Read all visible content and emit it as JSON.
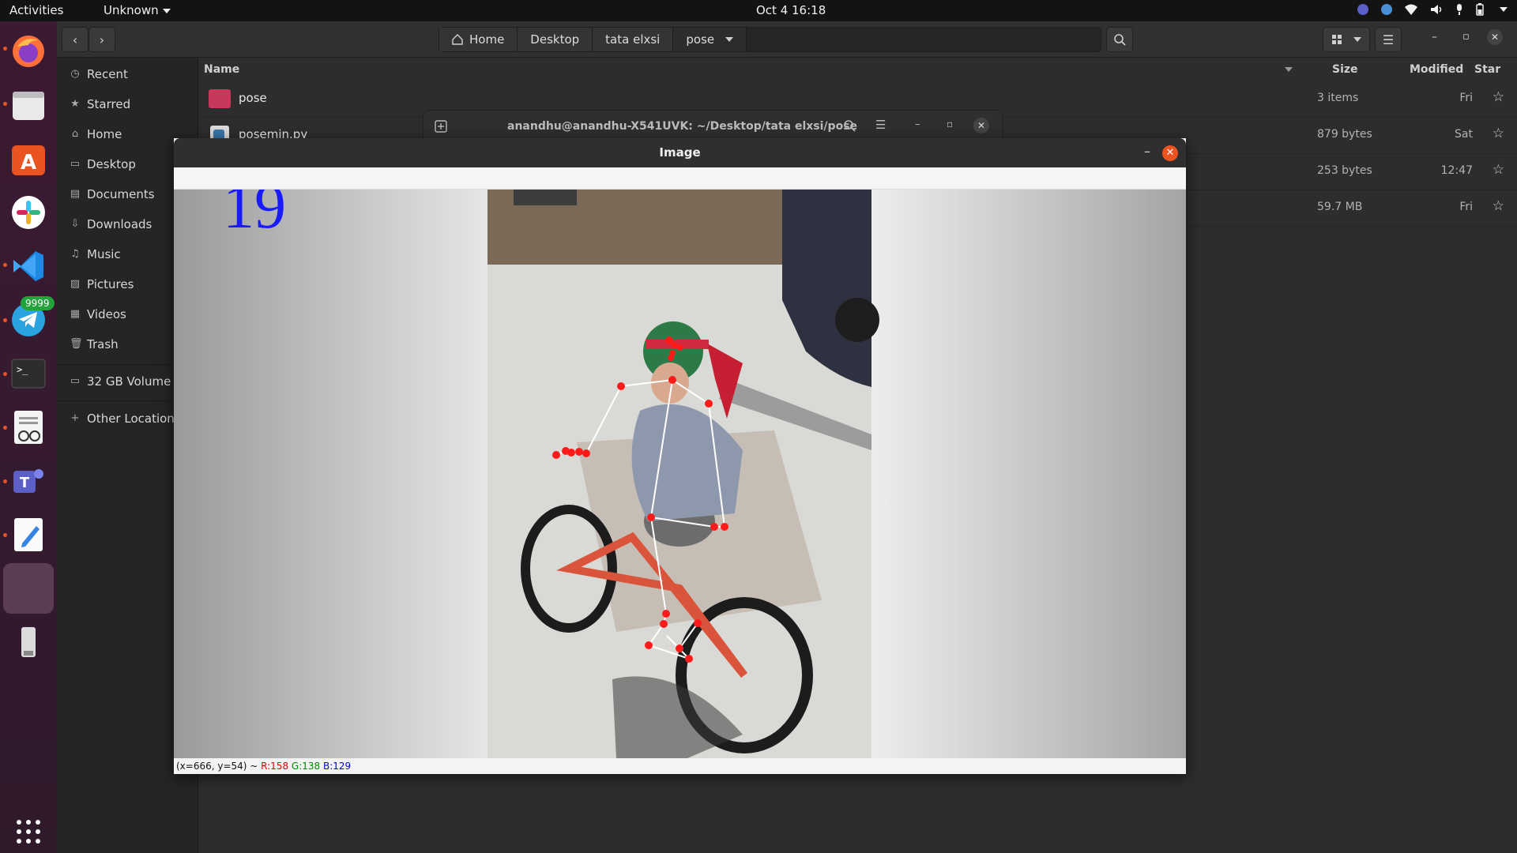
{
  "topbar": {
    "activities": "Activities",
    "app_menu": "Unknown",
    "clock": "Oct 4  16:18",
    "tray_icons": [
      "teams-tray-icon",
      "globe-icon",
      "wifi-icon",
      "volume-icon",
      "microphone-icon",
      "battery-icon",
      "chevron-down-icon"
    ]
  },
  "dock": {
    "apps": [
      "firefox",
      "files",
      "ubuntu-software",
      "slack",
      "vscode",
      "telegram",
      "terminal",
      "document-viewer",
      "teams",
      "text-editor",
      "show-apps-placeholder",
      "usb-drive"
    ],
    "telegram_badge": "9999"
  },
  "files": {
    "path": [
      "Home",
      "Desktop",
      "tata elxsi",
      "pose"
    ],
    "sidebar": {
      "items": [
        "Recent",
        "Starred",
        "Home",
        "Desktop",
        "Documents",
        "Downloads",
        "Music",
        "Pictures",
        "Videos",
        "Trash"
      ],
      "volume": "32 GB Volume",
      "other": "Other Locations"
    },
    "columns": {
      "name": "Name",
      "size": "Size",
      "modified": "Modified",
      "star": "Star"
    },
    "rows": [
      {
        "name": "pose",
        "size": "3 items",
        "modified": "Fri",
        "type": "folder"
      },
      {
        "name": "posemin.py",
        "size": "879 bytes",
        "modified": "Sat",
        "type": "python"
      },
      {
        "name": "",
        "size": "253 bytes",
        "modified": "12:47",
        "type": "file"
      },
      {
        "name": "",
        "size": "59.7 MB",
        "modified": "Fri",
        "type": "file"
      }
    ],
    "star_glyph": "☆"
  },
  "terminal": {
    "title": "anandhu@anandhu-X541UVK: ~/Desktop/tata elxsi/pose"
  },
  "image_window": {
    "title": "Image",
    "frame_counter": "19",
    "status": {
      "coords": "(x=666, y=54) ~ ",
      "r": "R:158",
      "g": "G:138",
      "b": "B:129"
    },
    "pose_color": "#ff1a1a",
    "counter_color": "#1a1aff"
  }
}
